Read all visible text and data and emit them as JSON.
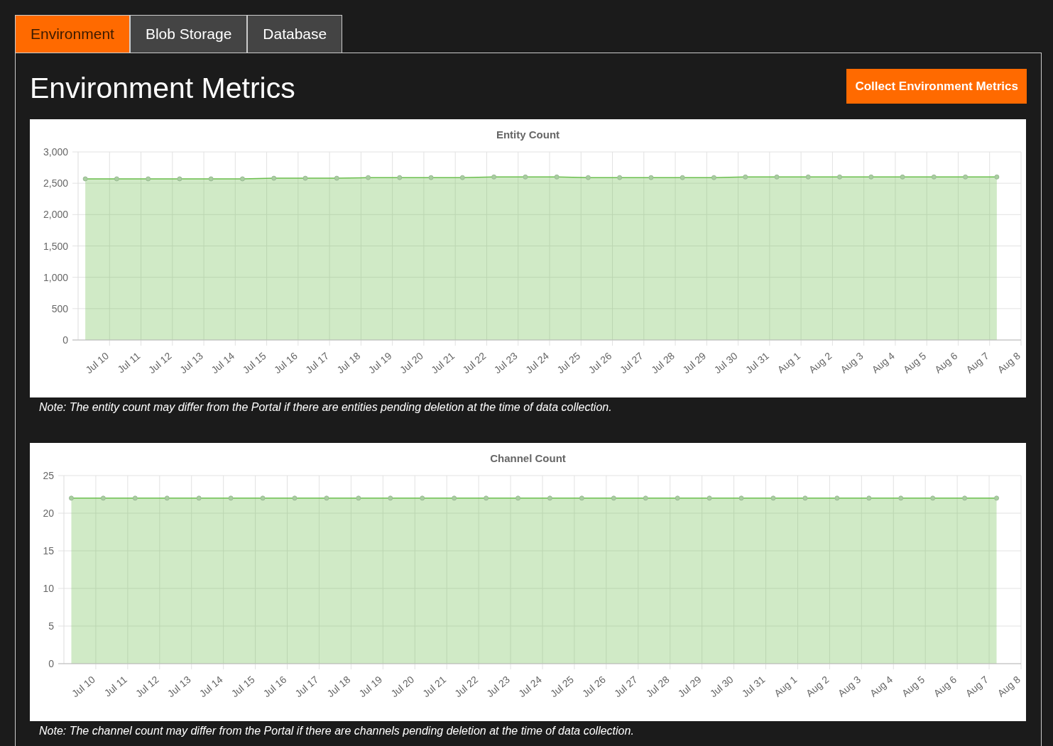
{
  "tabs": [
    {
      "label": "Environment",
      "selected": true
    },
    {
      "label": "Blob Storage",
      "selected": false
    },
    {
      "label": "Database",
      "selected": false
    }
  ],
  "title": "Environment Metrics",
  "collect_button": "Collect Environment Metrics",
  "charts": [
    {
      "chart_data": {
        "type": "area",
        "title": "Entity Count",
        "categories": [
          "Jul 10",
          "Jul 11",
          "Jul 12",
          "Jul 13",
          "Jul 14",
          "Jul 15",
          "Jul 16",
          "Jul 17",
          "Jul 18",
          "Jul 19",
          "Jul 20",
          "Jul 21",
          "Jul 22",
          "Jul 23",
          "Jul 24",
          "Jul 25",
          "Jul 26",
          "Jul 27",
          "Jul 28",
          "Jul 29",
          "Jul 30",
          "Jul 31",
          "Aug 1",
          "Aug 2",
          "Aug 3",
          "Aug 4",
          "Aug 5",
          "Aug 6",
          "Aug 7",
          "Aug 8"
        ],
        "grid": true,
        "series": [
          {
            "color": "#6cbf4f",
            "values": [
              2570,
              2570,
              2570,
              2570,
              2570,
              2570,
              2580,
              2580,
              2580,
              2590,
              2590,
              2590,
              2590,
              2600,
              2600,
              2600,
              2590,
              2590,
              2590,
              2590,
              2590,
              2600,
              2600,
              2600,
              2600,
              2600,
              2600,
              2600,
              2600,
              2600
            ]
          }
        ],
        "ylim": [
          0,
          3000
        ],
        "yticks": [
          {
            "value": 0,
            "label": "0"
          },
          {
            "value": 500,
            "label": "500"
          },
          {
            "value": 1000,
            "label": "1,000"
          },
          {
            "value": 1500,
            "label": "1,500"
          },
          {
            "value": 2000,
            "label": "2,000"
          },
          {
            "value": 2500,
            "label": "2,500"
          },
          {
            "value": 3000,
            "label": "3,000"
          }
        ]
      },
      "note": "Note: The entity count may differ from the Portal if there are entities pending deletion at the time of data collection."
    },
    {
      "chart_data": {
        "type": "area",
        "title": "Channel Count",
        "categories": [
          "Jul 10",
          "Jul 11",
          "Jul 12",
          "Jul 13",
          "Jul 14",
          "Jul 15",
          "Jul 16",
          "Jul 17",
          "Jul 18",
          "Jul 19",
          "Jul 20",
          "Jul 21",
          "Jul 22",
          "Jul 23",
          "Jul 24",
          "Jul 25",
          "Jul 26",
          "Jul 27",
          "Jul 28",
          "Jul 29",
          "Jul 30",
          "Jul 31",
          "Aug 1",
          "Aug 2",
          "Aug 3",
          "Aug 4",
          "Aug 5",
          "Aug 6",
          "Aug 7",
          "Aug 8"
        ],
        "grid": true,
        "series": [
          {
            "color": "#6cbf4f",
            "values": [
              22,
              22,
              22,
              22,
              22,
              22,
              22,
              22,
              22,
              22,
              22,
              22,
              22,
              22,
              22,
              22,
              22,
              22,
              22,
              22,
              22,
              22,
              22,
              22,
              22,
              22,
              22,
              22,
              22,
              22
            ]
          }
        ],
        "ylim": [
          0,
          25
        ],
        "yticks": [
          0,
          5,
          10,
          15,
          20,
          25
        ]
      },
      "note": "Note: The channel count may differ from the Portal if there are channels pending deletion at the time of data collection."
    }
  ]
}
